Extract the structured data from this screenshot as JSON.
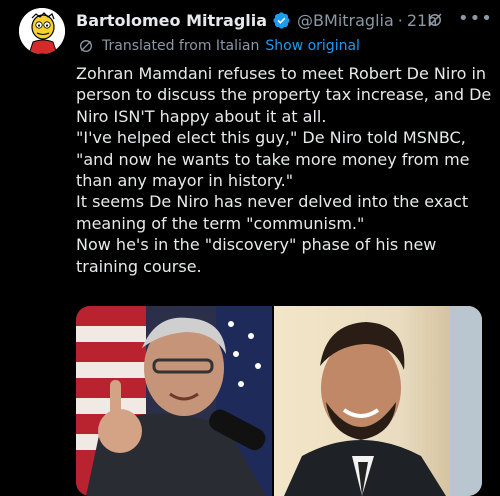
{
  "author": {
    "display_name": "Bartolomeo Mitraglia",
    "handle": "@BMitraglia",
    "separator": "·",
    "time": "21h",
    "verified_icon": "verified-badge-icon",
    "avatar_icon": "cartoon-avatar"
  },
  "translation": {
    "label": "Translated from Italian",
    "show_original": "Show original"
  },
  "tweet_lines": [
    "Zohran Mamdani refuses to meet Robert De Niro in",
    "person to discuss the property tax increase, and De",
    "Niro ISN'T happy about it at all.",
    "\"I've helped elect this guy,\" De Niro told MSNBC,",
    "\"and now he wants to take more money from me",
    "than any mayor in history.\"",
    "It seems De Niro has never delved into the exact",
    "meaning of the term \"communism.\"",
    "Now he's in the \"discovery\" phase of his new",
    "training course."
  ],
  "icons": {
    "grok": "grok-icon",
    "more": "more-options-icon",
    "translate": "translate-icon"
  },
  "colors": {
    "accent": "#1d9bf0",
    "muted": "#8b98a5",
    "text": "#e7e9ea",
    "background": "#000000"
  }
}
